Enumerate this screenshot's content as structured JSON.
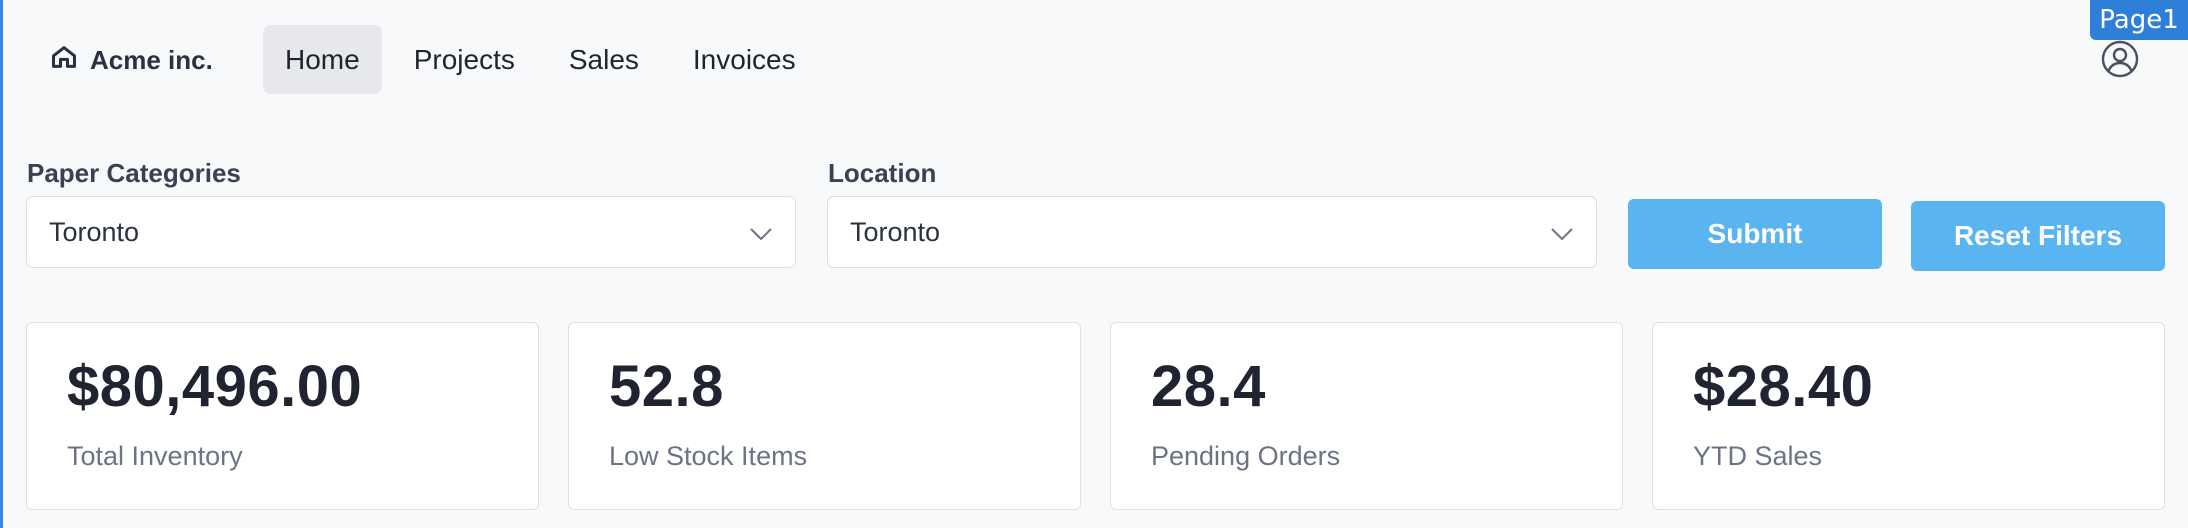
{
  "brand": {
    "name": "Acme inc.",
    "icon": "home-icon"
  },
  "nav": {
    "items": [
      {
        "label": "Home",
        "active": true
      },
      {
        "label": "Projects",
        "active": false
      },
      {
        "label": "Sales",
        "active": false
      },
      {
        "label": "Invoices",
        "active": false
      }
    ]
  },
  "page_badge": "Page1",
  "user": {
    "icon": "user-circle-icon"
  },
  "filters": {
    "paper_categories": {
      "label": "Paper Categories",
      "value": "Toronto"
    },
    "location": {
      "label": "Location",
      "value": "Toronto"
    },
    "submit_label": "Submit",
    "reset_label": "Reset Filters"
  },
  "kpis": [
    {
      "value": "$80,496.00",
      "label": "Total Inventory"
    },
    {
      "value": "52.8",
      "label": "Low Stock Items"
    },
    {
      "value": "28.4",
      "label": "Pending Orders"
    },
    {
      "value": "$28.40",
      "label": "YTD Sales"
    }
  ],
  "colors": {
    "accent": "#5ab4f0",
    "badge": "#2f7fd8",
    "background": "#f8f9fb"
  }
}
